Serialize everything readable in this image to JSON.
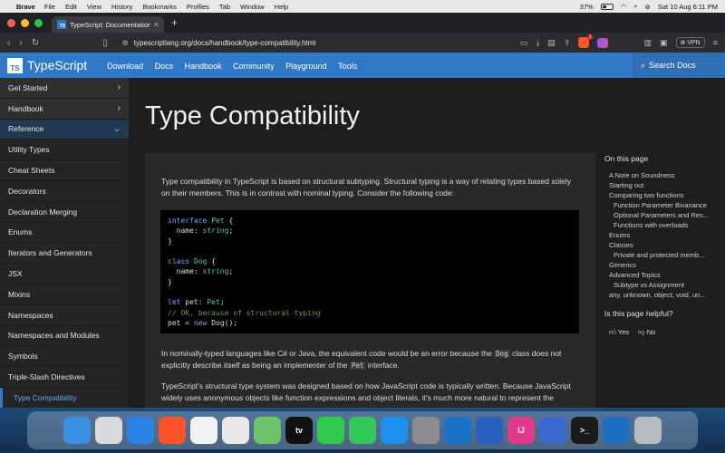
{
  "menubar": {
    "app": "Brave",
    "items": [
      "File",
      "Edit",
      "View",
      "History",
      "Bookmarks",
      "Profiles",
      "Tab",
      "Window",
      "Help"
    ],
    "battery": "37%",
    "datetime": "Sat 10 Aug  6:11 PM"
  },
  "browser": {
    "tab_title": "TypeScript: Documentation -",
    "url": "typescriptlang.org/docs/handbook/type-compatibility.html",
    "vpn_label": "VPN",
    "shield_badge": "1"
  },
  "site": {
    "logo_badge": "TS",
    "logo_text": "TypeScript",
    "nav": [
      "Download",
      "Docs",
      "Handbook",
      "Community",
      "Playground",
      "Tools"
    ],
    "search_label": "Search Docs"
  },
  "sidebar": {
    "items": [
      {
        "label": "Get Started"
      },
      {
        "label": "Handbook"
      },
      {
        "label": "Reference"
      },
      {
        "label": "Utility Types"
      },
      {
        "label": "Cheat Sheets"
      },
      {
        "label": "Decorators"
      },
      {
        "label": "Declaration Merging"
      },
      {
        "label": "Enums"
      },
      {
        "label": "Iterators and Generators"
      },
      {
        "label": "JSX"
      },
      {
        "label": "Mixins"
      },
      {
        "label": "Namespaces"
      },
      {
        "label": "Namespaces and Modules"
      },
      {
        "label": "Symbols"
      },
      {
        "label": "Triple-Slash Directives"
      },
      {
        "label": "Type Compatibility"
      }
    ]
  },
  "article": {
    "title": "Type Compatibility",
    "intro": "Type compatibility in TypeScript is based on structural subtyping. Structural typing is a way of relating types based solely on their members. This is in contrast with nominal typing. Consider the following code:",
    "code": {
      "l1_kw": "interface",
      "l1_ty": "Pet",
      "l1_rest": " {",
      "l2_prop": "  name: ",
      "l2_ty": "string",
      "l2_end": ";",
      "l3": "}",
      "l5_kw": "class",
      "l5_ty": "Dog",
      "l5_rest": " {",
      "l6_prop": "  name: ",
      "l6_ty": "string",
      "l6_end": ";",
      "l7": "}",
      "l9_kw": "let",
      "l9_mid": " pet: ",
      "l9_ty": "Pet",
      "l9_end": ";",
      "l10_comment": "// OK, because of structural typing",
      "l11_a": "pet = ",
      "l11_kw": "new",
      "l11_fn": "Dog",
      "l11_end": "();"
    },
    "p2_a": "In nominally-typed languages like C# or Java, the equivalent code would be an error because the ",
    "p2_code1": "Dog",
    "p2_b": " class does not explicitly describe itself as being an implementer of the ",
    "p2_code2": "Pet",
    "p2_c": " interface.",
    "p3": "TypeScript's structural type system was designed based on how JavaScript code is typically written. Because JavaScript widely uses anonymous objects like function expressions and object literals, it's much more natural to represent the"
  },
  "toc": {
    "heading": "On this page",
    "items": [
      {
        "label": "A Note on Soundness",
        "level": 1
      },
      {
        "label": "Starting out",
        "level": 1
      },
      {
        "label": "Comparing two functions",
        "level": 1
      },
      {
        "label": "Function Parameter Bivariance",
        "level": 2
      },
      {
        "label": "Optional Parameters and Res...",
        "level": 2
      },
      {
        "label": "Functions with overloads",
        "level": 2
      },
      {
        "label": "Enums",
        "level": 1
      },
      {
        "label": "Classes",
        "level": 1
      },
      {
        "label": "Private and protected memb...",
        "level": 2
      },
      {
        "label": "Generics",
        "level": 1
      },
      {
        "label": "Advanced Topics",
        "level": 1
      },
      {
        "label": "Subtype vs Assignment",
        "level": 2
      },
      {
        "label": "any, unknown, object, void, un...",
        "level": 1
      }
    ],
    "helpful_q": "Is this page helpful?",
    "yes": "Yes",
    "no": "No"
  },
  "dock": {
    "apps": [
      {
        "name": "finder-icon",
        "color": "#3b8fe0",
        "glyph": ""
      },
      {
        "name": "launchpad-icon",
        "color": "#d9d9de",
        "glyph": ""
      },
      {
        "name": "safari-icon",
        "color": "#2a82e4",
        "glyph": ""
      },
      {
        "name": "brave-icon",
        "color": "#fb542b",
        "glyph": ""
      },
      {
        "name": "photos-icon",
        "color": "#f2f2f2",
        "glyph": ""
      },
      {
        "name": "chrome-icon",
        "color": "#e8e8e8",
        "glyph": ""
      },
      {
        "name": "maps-icon",
        "color": "#6cc36a",
        "glyph": ""
      },
      {
        "name": "appletv-icon",
        "color": "#111111",
        "glyph": "tv"
      },
      {
        "name": "facetime-icon",
        "color": "#2fcb4e",
        "glyph": ""
      },
      {
        "name": "messages-icon",
        "color": "#32c85a",
        "glyph": ""
      },
      {
        "name": "appstore-icon",
        "color": "#1f8ff0",
        "glyph": ""
      },
      {
        "name": "settings-icon",
        "color": "#8b8b90",
        "glyph": ""
      },
      {
        "name": "vscode-icon",
        "color": "#1a73c8",
        "glyph": ""
      },
      {
        "name": "word-icon",
        "color": "#2b5fbf",
        "glyph": ""
      },
      {
        "name": "intellij-icon",
        "color": "#e03a8c",
        "glyph": "IJ"
      },
      {
        "name": "teams-icon",
        "color": "#3a6ad0",
        "glyph": ""
      },
      {
        "name": "terminal-icon",
        "color": "#1b1b1b",
        "glyph": ">_"
      },
      {
        "name": "vscode2-icon",
        "color": "#1f6fc1",
        "glyph": ""
      },
      {
        "name": "trash-icon",
        "color": "#b7bcc3",
        "glyph": ""
      }
    ]
  }
}
